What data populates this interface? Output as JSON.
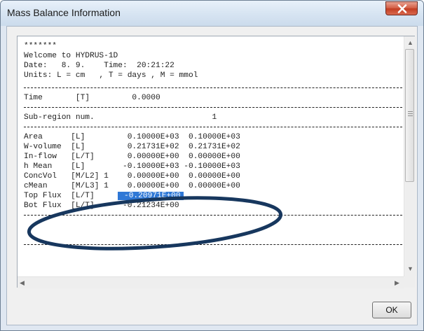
{
  "window": {
    "title": "Mass Balance Information",
    "close_icon": "close-icon"
  },
  "report": {
    "lines": [
      {
        "type": "text",
        "text": "*******"
      },
      {
        "type": "text",
        "text": "Welcome to HYDRUS-1D"
      },
      {
        "type": "text",
        "text": "Date:   8. 9.    Time:  20:21:22"
      },
      {
        "type": "text",
        "text": "Units: L = cm   , T = days , M = mmol"
      },
      {
        "type": "gap"
      },
      {
        "type": "sep"
      },
      {
        "type": "text",
        "text": "Time       [T]         0.0000"
      },
      {
        "type": "sep"
      },
      {
        "type": "text",
        "text": "Sub-region num.                         1"
      },
      {
        "type": "sep"
      },
      {
        "type": "text",
        "text": "Area      [L]         0.10000E+03  0.10000E+03"
      },
      {
        "type": "text",
        "text": "W-volume  [L]         0.21731E+02  0.21731E+02"
      },
      {
        "type": "text",
        "text": "In-flow   [L/T]       0.00000E+00  0.00000E+00"
      },
      {
        "type": "text",
        "text": "h Mean    [L]        -0.10000E+03 -0.10000E+03"
      },
      {
        "type": "text",
        "text": "ConcVol   [M/L2] 1    0.00000E+00  0.00000E+00"
      },
      {
        "type": "text",
        "text": "cMean     [M/L3] 1    0.00000E+00  0.00000E+00"
      },
      {
        "type": "text",
        "text": "Top Flux  [L/T]     ",
        "highlight": " -0.20971E+00"
      },
      {
        "type": "text",
        "text": "Bot Flux  [L/T]      -0.21234E+00"
      },
      {
        "type": "sep"
      },
      {
        "type": "blank"
      },
      {
        "type": "blank"
      },
      {
        "type": "sep"
      }
    ]
  },
  "buttons": {
    "ok": "OK"
  },
  "colors": {
    "selection": "#2f78d6",
    "annotation_ellipse": "#17375e",
    "close_button": "#c9452a"
  }
}
